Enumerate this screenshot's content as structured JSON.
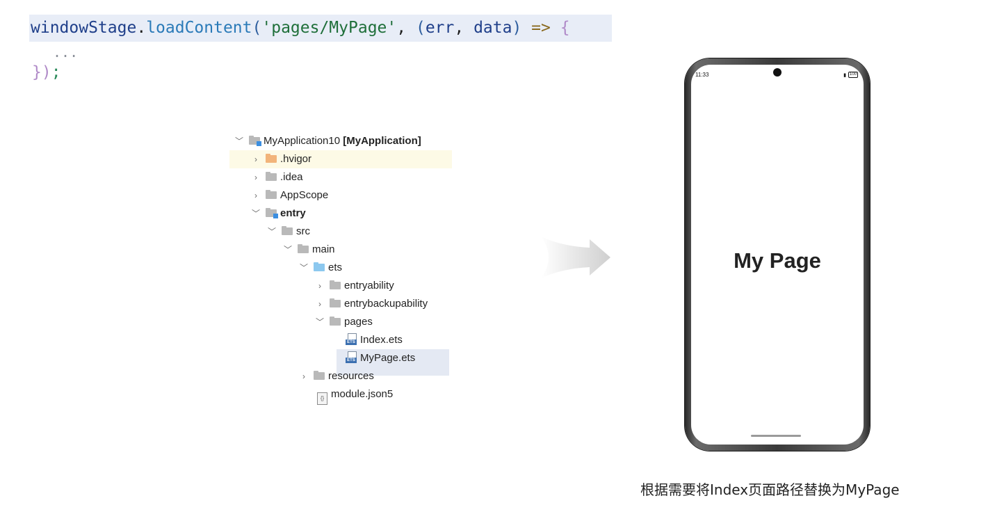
{
  "code": {
    "line1": {
      "obj": "windowStage",
      "dot": ".",
      "fn": "loadContent",
      "open_paren": "(",
      "str": "'pages/MyPage'",
      "comma1": ", ",
      "params_open": "(",
      "p1": "err",
      "comma2": ", ",
      "p2": "data",
      "params_close": ")",
      "arrow": " => ",
      "brace": "{"
    },
    "line2": "...",
    "line3": {
      "close": "})",
      "semi": ";"
    }
  },
  "tree": {
    "root": {
      "name": "MyApplication10",
      "tag": "[MyApplication]"
    },
    "items": {
      "hvigor": ".hvigor",
      "idea": ".idea",
      "appscope": "AppScope",
      "entry": "entry",
      "src": "src",
      "main": "main",
      "ets": "ets",
      "entryability": "entryability",
      "entrybackupability": "entrybackupability",
      "pages": "pages",
      "index": "Index.ets",
      "mypage": "MyPage.ets",
      "resources": "resources",
      "module": "module.json5"
    },
    "ets_tag": "ETS"
  },
  "phone": {
    "time": "11:33",
    "battery": "100",
    "title": "My Page"
  },
  "caption": "根据需要将Index页面路径替换为MyPage",
  "colors": {
    "code_highlight": "#e8edf7",
    "tree_highlight": "#fdfae6",
    "selected_row": "#e4e9f3"
  }
}
